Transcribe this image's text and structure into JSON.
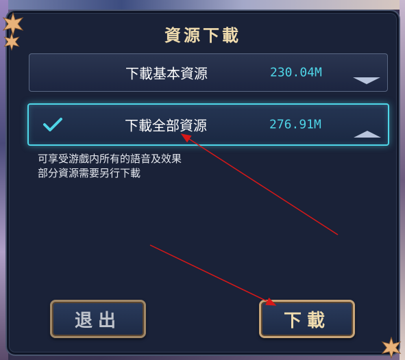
{
  "dialog": {
    "title": "資源下載",
    "options": [
      {
        "label": "下載基本資源",
        "size": "230.04M",
        "selected": false
      },
      {
        "label": "下載全部資源",
        "size": "276.91M",
        "selected": true
      }
    ],
    "description": [
      "可享受游戲内所有的語音及效果",
      "部分資源需要另行下載"
    ],
    "buttons": {
      "exit": "退出",
      "download": "下載"
    }
  },
  "colors": {
    "panel": "#1a2238",
    "accent": "#4fd6e8",
    "title": "#f0dcae",
    "annotation": "#d81818"
  }
}
